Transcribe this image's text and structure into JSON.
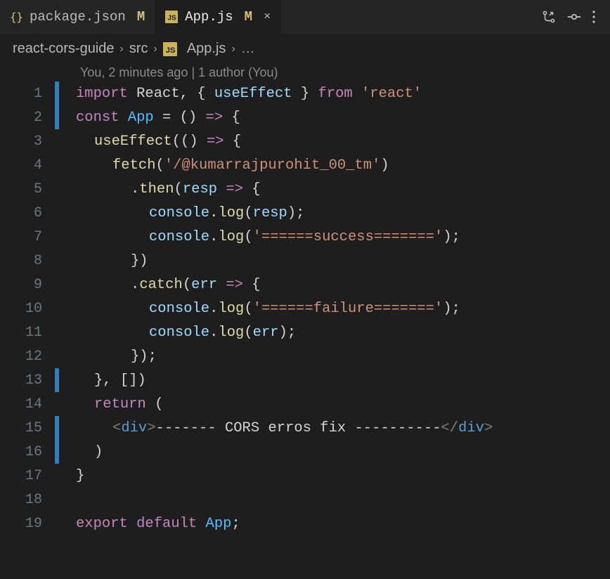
{
  "tabs": [
    {
      "name": "package.json",
      "modified": "M",
      "icon": "braces"
    },
    {
      "name": "App.js",
      "modified": "M",
      "icon": "js",
      "close": "×"
    }
  ],
  "breadcrumbs": {
    "root": "react-cors-guide",
    "folder": "src",
    "file": "App.js",
    "more": "…"
  },
  "gitlens": "You, 2 minutes ago | 1 author (You)",
  "code": {
    "lines": [
      {
        "n": 1,
        "decor": "blue",
        "tokens": [
          [
            "keyword",
            "import "
          ],
          [
            "default",
            "React, "
          ],
          [
            "punct",
            "{ "
          ],
          [
            "var",
            "useEffect"
          ],
          [
            "punct",
            " } "
          ],
          [
            "keyword",
            "from "
          ],
          [
            "string",
            "'react'"
          ]
        ]
      },
      {
        "n": 2,
        "decor": "blue",
        "tokens": [
          [
            "keyword",
            "const "
          ],
          [
            "const",
            "App"
          ],
          [
            "default",
            " = () "
          ],
          [
            "keyword",
            "=>"
          ],
          [
            "default",
            " {"
          ]
        ]
      },
      {
        "n": 3,
        "decor": "",
        "indent": 1,
        "tokens": [
          [
            "func",
            "useEffect"
          ],
          [
            "default",
            "(() "
          ],
          [
            "keyword",
            "=>"
          ],
          [
            "default",
            " {"
          ]
        ]
      },
      {
        "n": 4,
        "decor": "",
        "indent": 2,
        "tokens": [
          [
            "func",
            "fetch"
          ],
          [
            "default",
            "("
          ],
          [
            "string",
            "'/@kumarrajpurohit_00_tm'"
          ],
          [
            "default",
            ")"
          ]
        ]
      },
      {
        "n": 5,
        "decor": "",
        "indent": 3,
        "tokens": [
          [
            "default",
            "."
          ],
          [
            "func",
            "then"
          ],
          [
            "default",
            "("
          ],
          [
            "var",
            "resp"
          ],
          [
            "default",
            " "
          ],
          [
            "keyword",
            "=>"
          ],
          [
            "default",
            " {"
          ]
        ]
      },
      {
        "n": 6,
        "decor": "",
        "indent": 4,
        "tokens": [
          [
            "var",
            "console"
          ],
          [
            "default",
            "."
          ],
          [
            "func",
            "log"
          ],
          [
            "default",
            "("
          ],
          [
            "var",
            "resp"
          ],
          [
            "default",
            ");"
          ]
        ]
      },
      {
        "n": 7,
        "decor": "",
        "indent": 4,
        "tokens": [
          [
            "var",
            "console"
          ],
          [
            "default",
            "."
          ],
          [
            "func",
            "log"
          ],
          [
            "default",
            "("
          ],
          [
            "string",
            "'======success======='"
          ],
          [
            "default",
            ");"
          ]
        ]
      },
      {
        "n": 8,
        "decor": "",
        "indent": 3,
        "tokens": [
          [
            "default",
            "})"
          ]
        ]
      },
      {
        "n": 9,
        "decor": "",
        "indent": 3,
        "tokens": [
          [
            "default",
            "."
          ],
          [
            "func",
            "catch"
          ],
          [
            "default",
            "("
          ],
          [
            "var",
            "err"
          ],
          [
            "default",
            " "
          ],
          [
            "keyword",
            "=>"
          ],
          [
            "default",
            " {"
          ]
        ]
      },
      {
        "n": 10,
        "decor": "",
        "indent": 4,
        "tokens": [
          [
            "var",
            "console"
          ],
          [
            "default",
            "."
          ],
          [
            "func",
            "log"
          ],
          [
            "default",
            "("
          ],
          [
            "string",
            "'======failure======='"
          ],
          [
            "default",
            ");"
          ]
        ]
      },
      {
        "n": 11,
        "decor": "",
        "indent": 4,
        "tokens": [
          [
            "var",
            "console"
          ],
          [
            "default",
            "."
          ],
          [
            "func",
            "log"
          ],
          [
            "default",
            "("
          ],
          [
            "var",
            "err"
          ],
          [
            "default",
            ");"
          ]
        ]
      },
      {
        "n": 12,
        "decor": "",
        "indent": 3,
        "tokens": [
          [
            "default",
            "});"
          ]
        ]
      },
      {
        "n": 13,
        "decor": "blue",
        "indent": 1,
        "tokens": [
          [
            "default",
            "}, [])"
          ]
        ]
      },
      {
        "n": 14,
        "decor": "",
        "indent": 1,
        "tokens": [
          [
            "keyword",
            "return"
          ],
          [
            "default",
            " ("
          ]
        ]
      },
      {
        "n": 15,
        "decor": "blue",
        "indent": 2,
        "tokens": [
          [
            "jsx-br",
            "<"
          ],
          [
            "jsx-tag",
            "div"
          ],
          [
            "jsx-br",
            ">"
          ],
          [
            "default",
            "------- CORS erros fix ----------"
          ],
          [
            "jsx-br",
            "</"
          ],
          [
            "jsx-tag",
            "div"
          ],
          [
            "jsx-br",
            ">"
          ]
        ]
      },
      {
        "n": 16,
        "decor": "blue",
        "indent": 1,
        "tokens": [
          [
            "default",
            ")"
          ]
        ]
      },
      {
        "n": 17,
        "decor": "",
        "tokens": [
          [
            "default",
            "}"
          ]
        ]
      },
      {
        "n": 18,
        "decor": "",
        "tokens": []
      },
      {
        "n": 19,
        "decor": "",
        "tokens": [
          [
            "keyword",
            "export "
          ],
          [
            "keyword",
            "default "
          ],
          [
            "const",
            "App"
          ],
          [
            "default",
            ";"
          ]
        ]
      }
    ]
  }
}
